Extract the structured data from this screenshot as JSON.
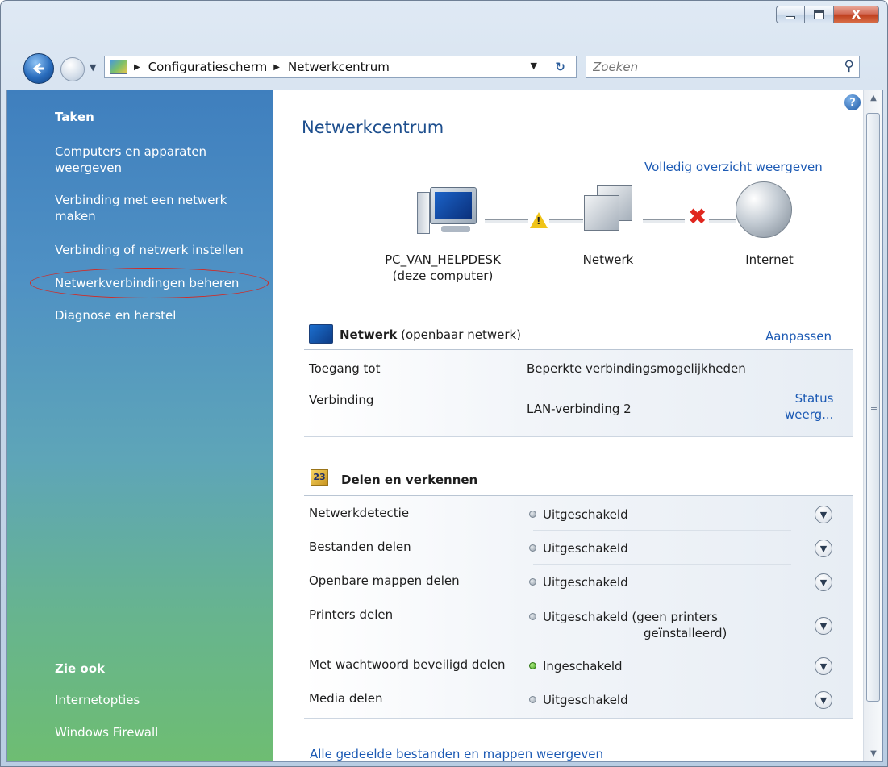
{
  "window": {
    "buttons": {
      "minimize": "minimize",
      "maximize": "maximize",
      "close": "X"
    }
  },
  "address": {
    "breadcrumbs": [
      "Configuratiescherm",
      "Netwerkcentrum"
    ],
    "search_placeholder": "Zoeken"
  },
  "sidebar": {
    "tasks_title": "Taken",
    "tasks": [
      "Computers en apparaten weergeven",
      "Verbinding met een netwerk maken",
      "Verbinding of netwerk instellen",
      "Netwerkverbindingen beheren",
      "Diagnose en herstel"
    ],
    "see_also_title": "Zie ook",
    "see_also": [
      "Internetopties",
      "Windows Firewall"
    ]
  },
  "main": {
    "title": "Netwerkcentrum",
    "full_view_link": "Volledig overzicht weergeven",
    "map": {
      "computer_name": "PC_VAN_HELPDESK",
      "computer_sub": "(deze computer)",
      "network_label": "Netwerk",
      "internet_label": "Internet"
    },
    "network_section": {
      "name": "Netwerk",
      "type": "(openbaar netwerk)",
      "customize_link": "Aanpassen",
      "rows": [
        {
          "label": "Toegang tot",
          "value": "Beperkte verbindingsmogelijkheden"
        },
        {
          "label": "Verbinding",
          "value": "LAN-verbinding 2",
          "link_line1": "Status",
          "link_line2": "weerg..."
        }
      ]
    },
    "sharing_section": {
      "title": "Delen en verkennen",
      "rows": [
        {
          "label": "Netwerkdetectie",
          "value": "Uitgeschakeld",
          "state": "off"
        },
        {
          "label": "Bestanden delen",
          "value": "Uitgeschakeld",
          "state": "off"
        },
        {
          "label": "Openbare mappen delen",
          "value": "Uitgeschakeld",
          "state": "off"
        },
        {
          "label": "Printers delen",
          "value": "Uitgeschakeld (geen printers",
          "value_line2": "geïnstalleerd)",
          "state": "off"
        },
        {
          "label": "Met wachtwoord beveiligd delen",
          "value": "Ingeschakeld",
          "state": "on"
        },
        {
          "label": "Media delen",
          "value": "Uitgeschakeld",
          "state": "off"
        }
      ]
    },
    "bottom_link": "Alle gedeelde bestanden en mappen weergeven"
  },
  "colors": {
    "link": "#1c5ab4",
    "title": "#1e4f8e",
    "highlight_oval": "#d7261e",
    "status_on": "#3c9a1b",
    "status_off": "#8f9aa6"
  }
}
